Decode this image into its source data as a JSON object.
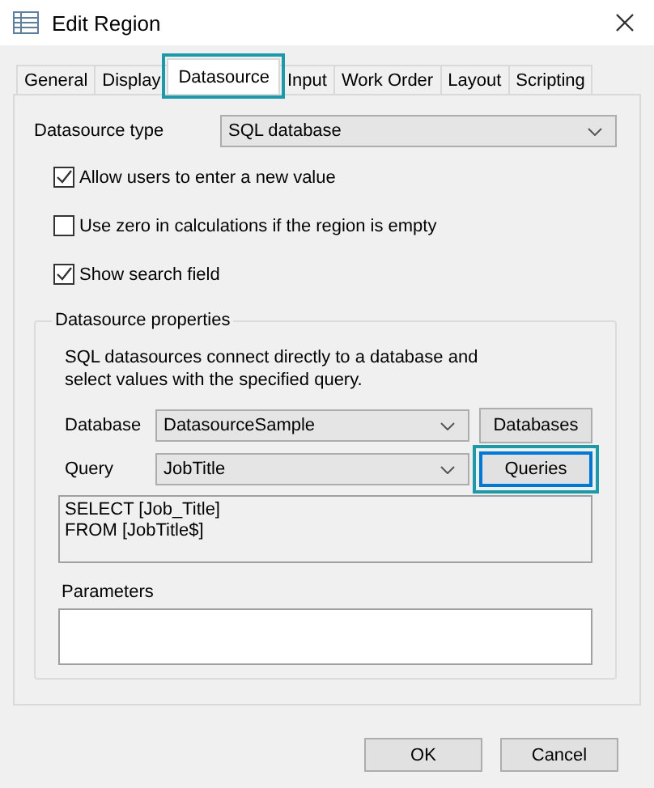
{
  "window": {
    "title": "Edit Region"
  },
  "tabs": [
    {
      "label": "General",
      "selected": false,
      "highlighted": false
    },
    {
      "label": "Display",
      "selected": false,
      "highlighted": false
    },
    {
      "label": "Datasource",
      "selected": true,
      "highlighted": true
    },
    {
      "label": "Input",
      "selected": false,
      "highlighted": false
    },
    {
      "label": "Work Order",
      "selected": false,
      "highlighted": false
    },
    {
      "label": "Layout",
      "selected": false,
      "highlighted": false
    },
    {
      "label": "Scripting",
      "selected": false,
      "highlighted": false
    }
  ],
  "datasource_type": {
    "label": "Datasource type",
    "value": "SQL database"
  },
  "options": [
    {
      "label": "Allow users to enter a new value",
      "checked": true
    },
    {
      "label": "Use zero in calculations if the region is empty",
      "checked": false
    },
    {
      "label": "Show search field",
      "checked": true
    }
  ],
  "properties": {
    "title": "Datasource properties",
    "description": "SQL datasources connect directly to a database and select values with the specified query.",
    "rows": [
      {
        "label": "Database",
        "value": "DatasourceSample",
        "button": "Databases",
        "highlighted": false
      },
      {
        "label": "Query",
        "value": "JobTitle",
        "button": "Queries",
        "highlighted": true
      }
    ],
    "query_text": [
      "SELECT [Job_Title]",
      "FROM [JobTitle$]"
    ],
    "parameters_label": "Parameters"
  },
  "buttons": [
    "OK",
    "Cancel"
  ]
}
